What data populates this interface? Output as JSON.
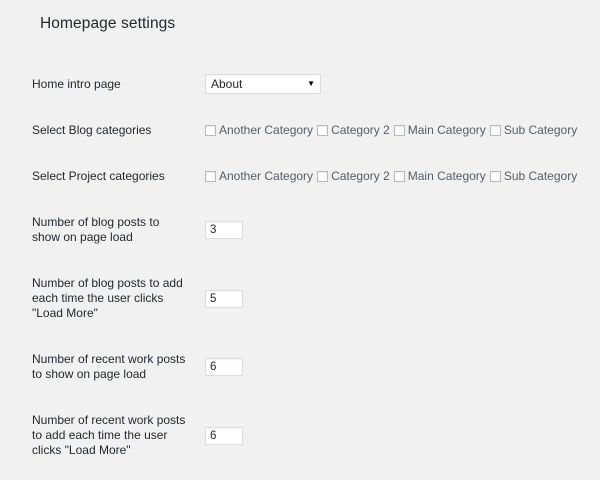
{
  "page": {
    "title": "Homepage settings"
  },
  "fields": {
    "home_intro": {
      "label": "Home intro page",
      "selected": "About"
    },
    "blog_categories": {
      "label": "Select Blog categories",
      "options": [
        "Another Category",
        "Category 2",
        "Main Category",
        "Sub Category"
      ]
    },
    "project_categories": {
      "label": "Select Project categories",
      "options": [
        "Another Category",
        "Category 2",
        "Main Category",
        "Sub Category"
      ]
    },
    "blog_posts_load": {
      "label": "Number of blog posts to show on page load",
      "value": "3"
    },
    "blog_posts_more": {
      "label": "Number of blog posts to add each time the user clicks \"Load More\"",
      "value": "5"
    },
    "work_posts_load": {
      "label": "Number of recent work posts to show on page load",
      "value": "6"
    },
    "work_posts_more": {
      "label": "Number of recent work posts to add each time the user clicks \"Load More\"",
      "value": "6"
    }
  },
  "icons": {
    "dropdown": "triangle-down-icon"
  },
  "colors": {
    "background": "#f1f1f1",
    "text": "#23282d",
    "border": "#dddddd"
  }
}
